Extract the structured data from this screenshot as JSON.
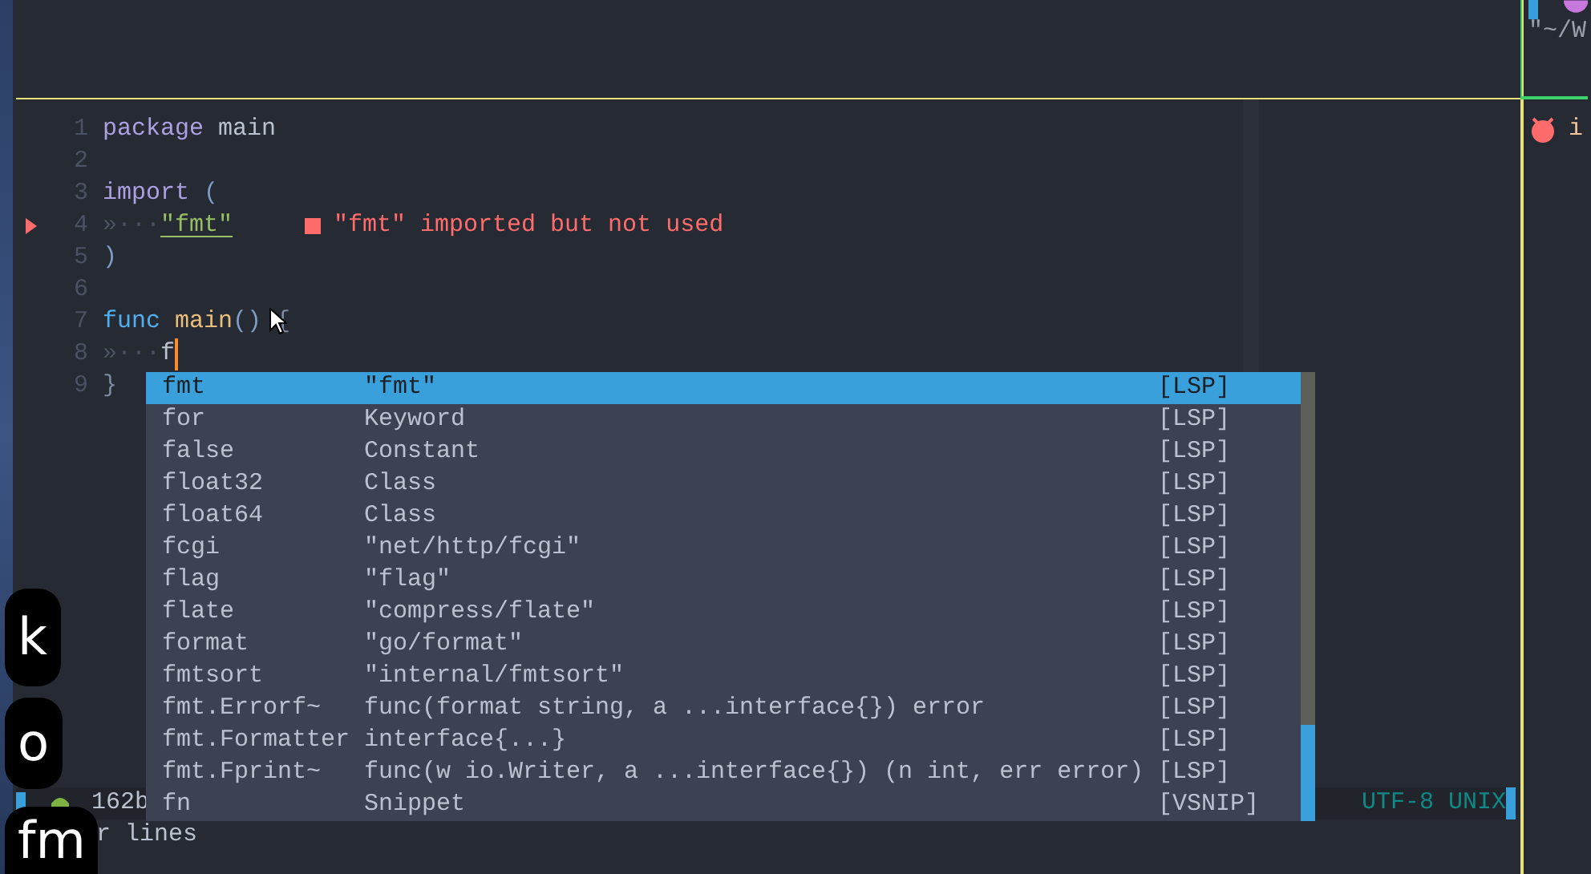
{
  "right_pane": {
    "path_text": "\"~/W",
    "item_text": "i"
  },
  "editor": {
    "lines": [
      {
        "number": "1",
        "sign": false,
        "tokens": [
          {
            "kind": "keyword",
            "text": "package"
          },
          {
            "kind": "identifier",
            "text": "main",
            "space_before": true
          }
        ]
      },
      {
        "number": "2",
        "sign": false
      },
      {
        "number": "3",
        "sign": false,
        "tokens": [
          {
            "kind": "keyword",
            "text": "import"
          },
          {
            "kind": "punctuation",
            "text": "(",
            "space_before": true
          }
        ]
      },
      {
        "number": "4",
        "sign": true,
        "tokens": [
          {
            "kind": "indent",
            "text": "»···"
          },
          {
            "kind": "string",
            "text": "\"fmt\""
          }
        ],
        "diagnostic": "\"fmt\" imported but not used"
      },
      {
        "number": "5",
        "sign": false,
        "tokens": [
          {
            "kind": "punctuation",
            "text": ")"
          }
        ]
      },
      {
        "number": "6",
        "sign": false
      },
      {
        "number": "7",
        "sign": false,
        "tokens": [
          {
            "kind": "func",
            "text": "func"
          },
          {
            "kind": "function",
            "text": "main",
            "space_before": true
          },
          {
            "kind": "punctuation",
            "text": "()"
          },
          {
            "kind": "brace",
            "text": "{",
            "space_before": true
          }
        ]
      },
      {
        "number": "8",
        "sign": false,
        "cursor": true,
        "tokens": [
          {
            "kind": "indent",
            "text": "»···"
          },
          {
            "kind": "identifier",
            "text": "f"
          }
        ]
      },
      {
        "number": "9",
        "sign": false,
        "tokens": [
          {
            "kind": "brace",
            "text": "}"
          }
        ]
      }
    ]
  },
  "completion": {
    "items": [
      {
        "word": "fmt",
        "menu": "\"fmt\"",
        "source": "[LSP]",
        "selected": true
      },
      {
        "word": "for",
        "menu": "Keyword",
        "source": "[LSP]",
        "selected": false
      },
      {
        "word": "false",
        "menu": "Constant",
        "source": "[LSP]",
        "selected": false
      },
      {
        "word": "float32",
        "menu": "Class",
        "source": "[LSP]",
        "selected": false
      },
      {
        "word": "float64",
        "menu": "Class",
        "source": "[LSP]",
        "selected": false
      },
      {
        "word": "fcgi",
        "menu": "\"net/http/fcgi\"",
        "source": "[LSP]",
        "selected": false
      },
      {
        "word": "flag",
        "menu": "\"flag\"",
        "source": "[LSP]",
        "selected": false
      },
      {
        "word": "flate",
        "menu": "\"compress/flate\"",
        "source": "[LSP]",
        "selected": false
      },
      {
        "word": "format",
        "menu": "\"go/format\"",
        "source": "[LSP]",
        "selected": false
      },
      {
        "word": "fmtsort",
        "menu": "\"internal/fmtsort\"",
        "source": "[LSP]",
        "selected": false
      },
      {
        "word": "fmt.Errorf~",
        "menu": "func(format string, a ...interface{}) error",
        "source": "[LSP]",
        "selected": false
      },
      {
        "word": "fmt.Formatter",
        "menu": "interface{...}",
        "source": "[LSP]",
        "selected": false
      },
      {
        "word": "fmt.Fprint~",
        "menu": "func(w io.Writer, a ...interface{}) (n int, err error)",
        "source": "[LSP]",
        "selected": false
      },
      {
        "word": "fn",
        "menu": "Snippet",
        "source": "[VSNIP]",
        "selected": false
      }
    ]
  },
  "status_bar": {
    "size": "162b",
    "encoding": "UTF-8 UNIX"
  },
  "command_line": "r lines",
  "key_overlays": [
    "k",
    "o",
    "fm"
  ]
}
